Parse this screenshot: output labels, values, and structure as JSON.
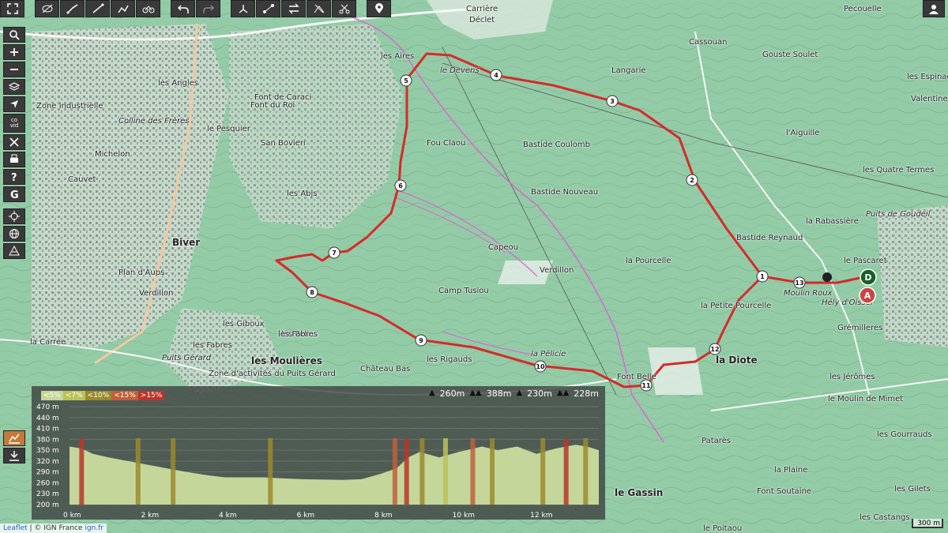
{
  "toolbar": {
    "buttons": [
      "fullscreen-icon",
      "eye-off-icon",
      "route-icon",
      "line-icon",
      "waypoints-icon",
      "bike-icon",
      "undo-icon",
      "redo-icon",
      "branch-icon",
      "nodes-icon",
      "swap-icon",
      "delete-icon",
      "cut-icon",
      "marker-icon"
    ]
  },
  "sidebar": {
    "buttons": [
      "search-icon",
      "zoom-in-icon",
      "zoom-out-icon",
      "layers-icon",
      "locate-icon",
      "cross-icon",
      "print-icon",
      "help-icon",
      "geo-icon",
      "crosshair-icon",
      "globe-icon",
      "layers-stack-icon"
    ],
    "co_label": "co\nvid",
    "bottom": [
      "chart-icon",
      "download-icon"
    ]
  },
  "map": {
    "labels": [
      {
        "text": "Pecouelle",
        "cls": ""
      },
      {
        "text": "Gouste Soulet",
        "cls": ""
      },
      {
        "text": "Cassouan",
        "cls": ""
      },
      {
        "text": "Carrière",
        "cls": ""
      },
      {
        "text": "Déclet",
        "cls": ""
      },
      {
        "text": "le Devens",
        "cls": "italic"
      },
      {
        "text": "les Aires",
        "cls": ""
      },
      {
        "text": "Langarie",
        "cls": ""
      },
      {
        "text": "les Espinade",
        "cls": ""
      },
      {
        "text": "Valentine",
        "cls": ""
      },
      {
        "text": "les Quatre Termes",
        "cls": ""
      },
      {
        "text": "l'Aiguille",
        "cls": ""
      },
      {
        "text": "Puits de Goudeil",
        "cls": "italic"
      },
      {
        "text": "la Rabassière",
        "cls": ""
      },
      {
        "text": "Bastide Reynaud",
        "cls": ""
      },
      {
        "text": "le Pascaret",
        "cls": ""
      },
      {
        "text": "Moulin Roux",
        "cls": "italic"
      },
      {
        "text": "Hély d'Oissel",
        "cls": "italic"
      },
      {
        "text": "Grémilleres",
        "cls": ""
      },
      {
        "text": "Bastide Coulomb",
        "cls": ""
      },
      {
        "text": "Bastide Nouveau",
        "cls": ""
      },
      {
        "text": "Fou Claou",
        "cls": ""
      },
      {
        "text": "la Pourcelle",
        "cls": ""
      },
      {
        "text": "la Petite Pourcelle",
        "cls": ""
      },
      {
        "text": "Capeou",
        "cls": ""
      },
      {
        "text": "Verdillon",
        "cls": ""
      },
      {
        "text": "Camp Tusiou",
        "cls": ""
      },
      {
        "text": "la Diote",
        "cls": "big"
      },
      {
        "text": "la Pélicie",
        "cls": "italic"
      },
      {
        "text": "Font Belle",
        "cls": ""
      },
      {
        "text": "Château Bas",
        "cls": ""
      },
      {
        "text": "les Rigauds",
        "cls": ""
      },
      {
        "text": "les Moulières",
        "cls": "big"
      },
      {
        "text": "les Giboux",
        "cls": ""
      },
      {
        "text": "les Pelins",
        "cls": ""
      },
      {
        "text": "Biver",
        "cls": "big"
      },
      {
        "text": "les Angles",
        "cls": ""
      },
      {
        "text": "Font du Roi",
        "cls": ""
      },
      {
        "text": "Font de Caraci",
        "cls": ""
      },
      {
        "text": "San Bovieri",
        "cls": ""
      },
      {
        "text": "les Abjs",
        "cls": ""
      },
      {
        "text": "le Pesquier",
        "cls": ""
      },
      {
        "text": "Michelon",
        "cls": ""
      },
      {
        "text": "Cauvet",
        "cls": ""
      },
      {
        "text": "Colline des Frères",
        "cls": "italic"
      },
      {
        "text": "Zone Industrielle",
        "cls": ""
      },
      {
        "text": "Plan d'Aups",
        "cls": ""
      },
      {
        "text": "les Fabres",
        "cls": ""
      },
      {
        "text": "Puits Gérard",
        "cls": "italic"
      },
      {
        "text": "la Carrée",
        "cls": ""
      },
      {
        "text": "Zone d'activités du Puits Gérard",
        "cls": ""
      },
      {
        "text": "les Jérômes",
        "cls": ""
      },
      {
        "text": "le Moulin de Mimet",
        "cls": ""
      },
      {
        "text": "les Gourrauds",
        "cls": ""
      },
      {
        "text": "Patarès",
        "cls": ""
      },
      {
        "text": "la Plaine",
        "cls": ""
      },
      {
        "text": "les Gilets",
        "cls": ""
      },
      {
        "text": "Font Soutaine",
        "cls": ""
      },
      {
        "text": "le Gassin",
        "cls": "big"
      },
      {
        "text": "les Castangs",
        "cls": ""
      },
      {
        "text": "le Poitaou",
        "cls": ""
      },
      {
        "text": "Verdillon",
        "cls": ""
      },
      {
        "text": "les Fabres",
        "cls": ""
      }
    ],
    "waypoints": [
      "1",
      "2",
      "3",
      "4",
      "5",
      "6",
      "7",
      "8",
      "9",
      "10",
      "11",
      "12",
      "13"
    ],
    "start_label": "D",
    "end_label": "A",
    "colors": {
      "route": "#d62a2a",
      "start": "#1a5f2a",
      "end": "#c94545"
    }
  },
  "elevation": {
    "legend": [
      {
        "label": "<5%",
        "color": "#c5d69a"
      },
      {
        "label": "<7%",
        "color": "#b8c25a"
      },
      {
        "label": "<10%",
        "color": "#9a8a2e"
      },
      {
        "label": "<15%",
        "color": "#c0603a"
      },
      {
        "label": ">15%",
        "color": "#b8362a"
      }
    ],
    "stats": {
      "up": "260m",
      "max": "388m",
      "down": "230m",
      "min": "228m"
    },
    "y_ticks": [
      "470 m",
      "440 m",
      "410 m",
      "380 m",
      "350 m",
      "320 m",
      "290 m",
      "260 m",
      "230 m",
      "200 m"
    ],
    "x_ticks": [
      "0 km",
      "2 km",
      "4 km",
      "6 km",
      "8 km",
      "10 km",
      "12 km"
    ],
    "ylim": [
      200,
      470
    ]
  },
  "attribution": {
    "leaflet": "Leaflet",
    "sep": " | © ",
    "ign": "IGN France",
    "ign_link": "ign.fr"
  },
  "scale": {
    "label": "300 m"
  }
}
